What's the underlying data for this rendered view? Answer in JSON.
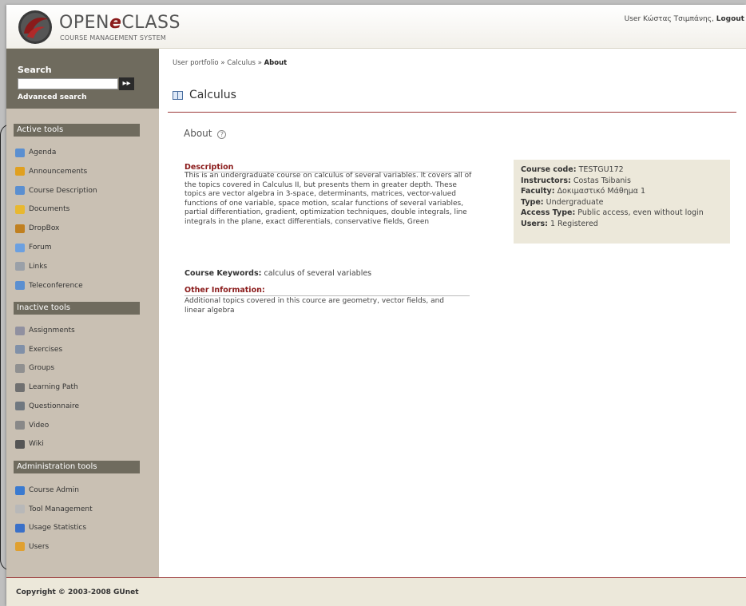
{
  "header": {
    "logo_open": "OPEN",
    "logo_e": "e",
    "logo_class": "CLASS",
    "logo_sub": "COURSE MANAGEMENT SYSTEM",
    "user_text": "User Κώστας Τσιμπάνης,",
    "logout": "Logout"
  },
  "search": {
    "title": "Search",
    "value": "",
    "go_glyph": "▸▸",
    "advanced": "Advanced search"
  },
  "active_tools": {
    "title": "Active tools",
    "items": [
      {
        "label": "Agenda",
        "icon": "agenda-icon",
        "color": "#5b8fd0"
      },
      {
        "label": "Announcements",
        "icon": "announcements-icon",
        "color": "#e0a020"
      },
      {
        "label": "Course Description",
        "icon": "course-description-icon",
        "color": "#5b8fd0"
      },
      {
        "label": "Documents",
        "icon": "documents-icon",
        "color": "#e8b830"
      },
      {
        "label": "DropBox",
        "icon": "dropbox-icon",
        "color": "#c08020"
      },
      {
        "label": "Forum",
        "icon": "forum-icon",
        "color": "#6ca0e0"
      },
      {
        "label": "Links",
        "icon": "links-icon",
        "color": "#9aa0a8"
      },
      {
        "label": "Teleconference",
        "icon": "teleconference-icon",
        "color": "#5b8fd0"
      }
    ]
  },
  "inactive_tools": {
    "title": "Inactive tools",
    "items": [
      {
        "label": "Assignments",
        "icon": "assignments-icon",
        "color": "#9090a0"
      },
      {
        "label": "Exercises",
        "icon": "exercises-icon",
        "color": "#8090a8"
      },
      {
        "label": "Groups",
        "icon": "groups-icon",
        "color": "#909090"
      },
      {
        "label": "Learning Path",
        "icon": "learning-path-icon",
        "color": "#707070"
      },
      {
        "label": "Questionnaire",
        "icon": "questionnaire-icon",
        "color": "#707880"
      },
      {
        "label": "Video",
        "icon": "video-icon",
        "color": "#888888"
      },
      {
        "label": "Wiki",
        "icon": "wiki-icon",
        "color": "#555555"
      }
    ]
  },
  "admin_tools": {
    "title": "Administration tools",
    "items": [
      {
        "label": "Course Admin",
        "icon": "course-admin-icon",
        "color": "#3a7ad0"
      },
      {
        "label": "Tool Management",
        "icon": "tool-management-icon",
        "color": "#b8b8b8"
      },
      {
        "label": "Usage Statistics",
        "icon": "usage-statistics-icon",
        "color": "#3a70c8"
      },
      {
        "label": "Users",
        "icon": "users-icon",
        "color": "#e0a030"
      }
    ]
  },
  "breadcrumb": {
    "part1": "User portfolio",
    "sep": "»",
    "part2": "Calculus",
    "current": "About"
  },
  "course": {
    "title": "Calculus",
    "about": "About",
    "help_glyph": "?"
  },
  "description": {
    "heading": "Description",
    "text": "This is an undergraduate course on calculus of several variables. It covers all of the topics covered in Calculus II, but presents them in greater depth. These topics are vector algebra in 3-space, determinants, matrices, vector-valued functions of one variable, space motion, scalar functions of several variables, partial differentiation, gradient, optimization techniques, double integrals, line integrals in the plane, exact differentials, conservative fields, Green",
    "keywords_label": "Course Keywords:",
    "keywords": "calculus of several variables",
    "other_heading": "Other Information:",
    "other_text": "Additional topics covered in this cource are geometry, vector fields, and linear algebra"
  },
  "info": {
    "code_label": "Course code:",
    "code": "TESTGU172",
    "instructors_label": "Instructors:",
    "instructors": "Costas Tsibanis",
    "faculty_label": "Faculty:",
    "faculty": "Δοκιμαστικό Μάθημα 1",
    "type_label": "Type:",
    "type": "Undergraduate",
    "access_label": "Access Type:",
    "access": "Public access, even without login",
    "users_label": "Users:",
    "users": "1 Registered"
  },
  "footer": {
    "copyright": "Copyright © 2003-2008 GUnet"
  },
  "colors": {
    "accent": "#8a1a1a",
    "sidebar_bg": "#c9c0b3",
    "section_bg": "#6f6b5e",
    "info_bg": "#ece8da"
  }
}
